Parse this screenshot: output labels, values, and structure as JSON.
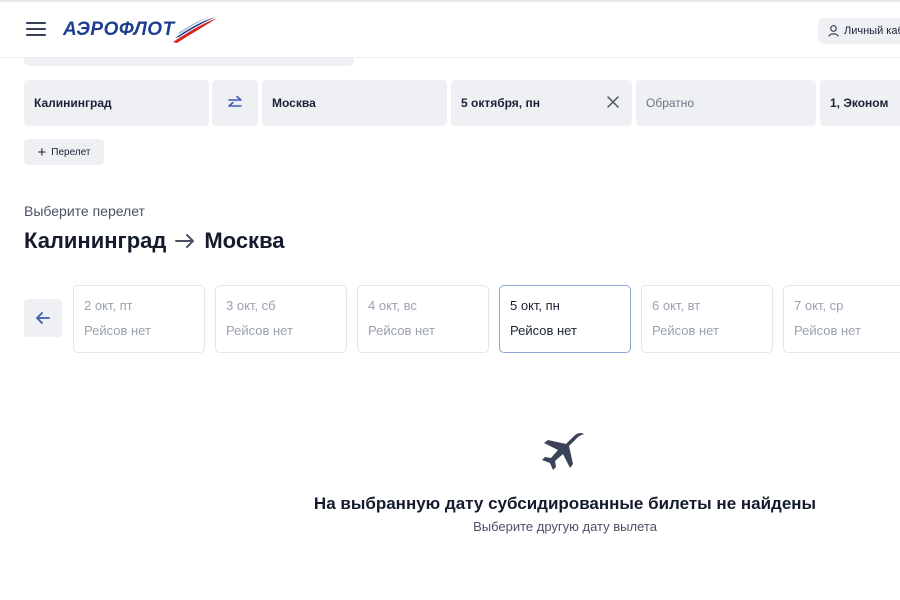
{
  "header": {
    "logo_text": "АЭРОФЛОТ",
    "account_label": "Личный кабинет"
  },
  "search": {
    "from": "Калининград",
    "to": "Москва",
    "depart": "5 октября, пн",
    "return_placeholder": "Обратно",
    "passengers": "1, Эконом",
    "add_flight_label": "Перелет"
  },
  "results": {
    "choose_label": "Выберите перелет",
    "origin": "Калининград",
    "destination": "Москва",
    "dates": [
      {
        "date": "2 окт, пт",
        "status": "Рейсов нет",
        "selected": false
      },
      {
        "date": "3 окт, сб",
        "status": "Рейсов нет",
        "selected": false
      },
      {
        "date": "4 окт, вс",
        "status": "Рейсов нет",
        "selected": false
      },
      {
        "date": "5 окт, пн",
        "status": "Рейсов нет",
        "selected": true
      },
      {
        "date": "6 окт, вт",
        "status": "Рейсов нет",
        "selected": false
      },
      {
        "date": "7 окт, ср",
        "status": "Рейсов нет",
        "selected": false
      }
    ],
    "empty_title": "На выбранную дату субсидированные билеты не найдены",
    "empty_subtitle": "Выберите другую дату вылета"
  },
  "colors": {
    "brand_blue": "#1d3d8f",
    "field_bg": "#eef0f4",
    "selected_border": "#8ea3d6"
  },
  "icons": [
    "menu-icon",
    "user-icon",
    "swap-icon",
    "close-icon",
    "plus-icon",
    "arrow-left-icon",
    "airplane-icon"
  ]
}
